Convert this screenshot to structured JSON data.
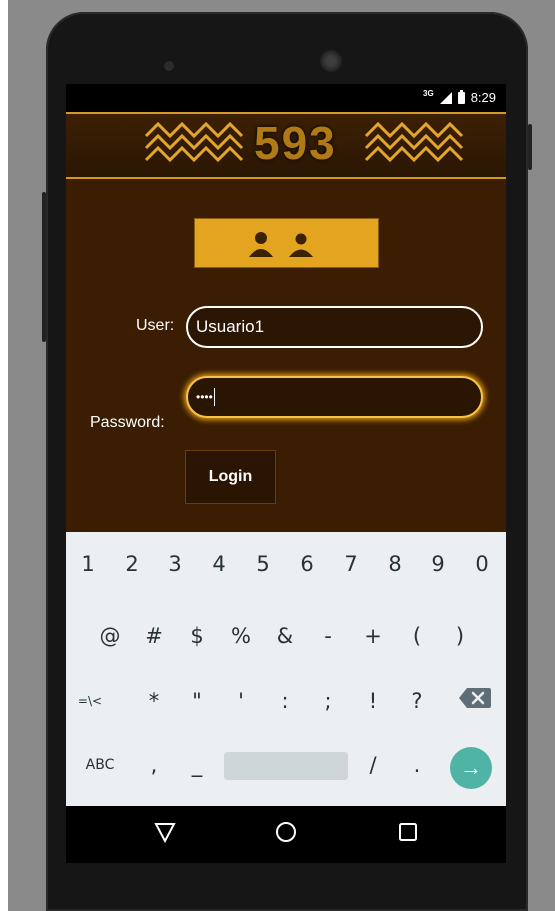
{
  "status_bar": {
    "network": "3G",
    "time": "8:29"
  },
  "banner": {
    "text": "593"
  },
  "form": {
    "user_label": "User:",
    "user_value": "Usuario1",
    "password_label": "Password:",
    "password_value": "••••",
    "login_label": "Login"
  },
  "keyboard": {
    "row1": [
      "1",
      "2",
      "3",
      "4",
      "5",
      "6",
      "7",
      "8",
      "9",
      "0"
    ],
    "row2": [
      "@",
      "#",
      "$",
      "%",
      "&",
      "-",
      "+",
      "(",
      ")"
    ],
    "row3": [
      "=\\<",
      "*",
      "\"",
      "'",
      ":",
      ";",
      "!",
      "?"
    ],
    "row4": {
      "abc": "ABC",
      "comma": ",",
      "underscore": "_",
      "slash": "/",
      "period": "."
    }
  },
  "colors": {
    "app_bg": "#3a1d02",
    "accent": "#e3a51f",
    "enter": "#4fb3a6"
  },
  "icons": [
    "signal-icon",
    "battery-icon",
    "users-icon",
    "backspace-icon",
    "enter-arrow-icon",
    "back-nav-icon",
    "home-nav-icon",
    "recents-nav-icon"
  ]
}
